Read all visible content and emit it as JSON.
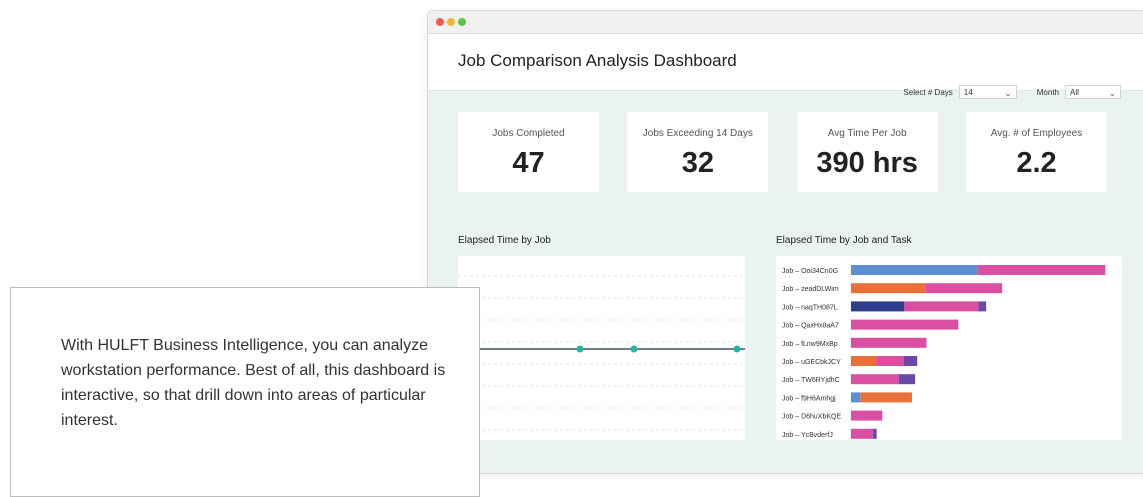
{
  "dashboard": {
    "title": "Job Comparison Analysis Dashboard"
  },
  "filters": {
    "days_label": "Select # Days",
    "days_value": "14",
    "month_label": "Month",
    "month_value": "All"
  },
  "kpis": [
    {
      "label": "Jobs Completed",
      "value": "47"
    },
    {
      "label": "Jobs Exceeding 14 Days",
      "value": "32"
    },
    {
      "label": "Avg Time Per Job",
      "value": "390 hrs"
    },
    {
      "label": "Avg. # of Employees",
      "value": "2.2"
    }
  ],
  "sections": {
    "line_title": "Elapsed Time by Job",
    "bar_title": "Elapsed Time by Job and Task"
  },
  "popup": {
    "text": "With HULFT Business Intelligence, you can analyze workstation performance. Best of all, this dashboard is interactive, so that drill down into areas of particular interest."
  },
  "colors": {
    "blue": "#5b8fd0",
    "pink": "#db4fa2",
    "orange": "#e8713a",
    "navy": "#2f3e8a",
    "purple": "#6a4aa8",
    "teal": "#1fb6a3"
  },
  "chart_data": [
    {
      "type": "line",
      "title": "Elapsed Time by Job",
      "points_visible": 3,
      "grid": true
    },
    {
      "type": "bar",
      "orientation": "horizontal",
      "stacked": true,
      "title": "Elapsed Time by Job and Task",
      "categories": [
        "Job – Ooi34Cn0G",
        "Job – zeadDLWim",
        "Job – naqTH087L",
        "Job – QaxHx8aA7",
        "Job – fLnw9MxBp",
        "Job – uGECbkJCY",
        "Job – TW6RYjdhC",
        "Job – f9H6Amhgj",
        "Job – D6huXbKQE",
        "Job – YcBvderfJ"
      ],
      "xlim": [
        0,
        1000
      ],
      "series": [
        {
          "color": "#5b8fd0",
          "values": [
            478,
            0,
            0,
            0,
            0,
            0,
            0,
            35,
            0,
            0
          ]
        },
        {
          "color": "#e8713a",
          "values": [
            0,
            280,
            0,
            0,
            0,
            95,
            0,
            195,
            0,
            0
          ]
        },
        {
          "color": "#2f3e8a",
          "values": [
            0,
            0,
            200,
            0,
            0,
            0,
            0,
            0,
            0,
            0
          ]
        },
        {
          "color": "#db4fa2",
          "values": [
            482,
            290,
            280,
            405,
            285,
            105,
            180,
            0,
            118,
            82
          ]
        },
        {
          "color": "#6a4aa8",
          "values": [
            0,
            0,
            30,
            0,
            0,
            50,
            62,
            0,
            0,
            15
          ]
        }
      ]
    }
  ]
}
